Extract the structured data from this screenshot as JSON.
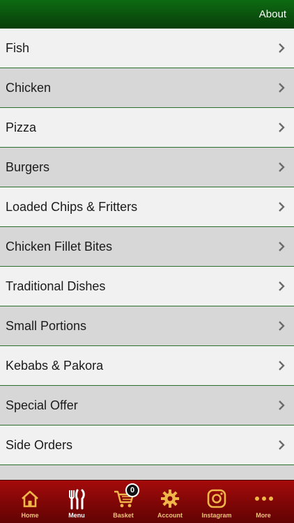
{
  "header": {
    "about_label": "About"
  },
  "menu": {
    "items": [
      {
        "label": "Fish"
      },
      {
        "label": "Chicken"
      },
      {
        "label": "Pizza"
      },
      {
        "label": "Burgers"
      },
      {
        "label": "Loaded Chips & Fritters"
      },
      {
        "label": "Chicken Fillet Bites"
      },
      {
        "label": "Traditional Dishes"
      },
      {
        "label": "Small Portions"
      },
      {
        "label": "Kebabs & Pakora"
      },
      {
        "label": "Special Offer"
      },
      {
        "label": "Side Orders"
      },
      {
        "label": ""
      }
    ]
  },
  "tabbar": {
    "tabs": [
      {
        "label": "Home",
        "icon": "home-icon"
      },
      {
        "label": "Menu",
        "icon": "cutlery-icon"
      },
      {
        "label": "Basket",
        "icon": "cart-icon"
      },
      {
        "label": "Account",
        "icon": "gear-icon"
      },
      {
        "label": "Instagram",
        "icon": "instagram-icon"
      },
      {
        "label": "More",
        "icon": "more-dots-icon"
      }
    ],
    "basket_count": "0"
  },
  "colors": {
    "header_green": "#0a4f0d",
    "tabbar_red": "#7e0606",
    "tab_label_gold": "#f0c47a",
    "divider_green": "#2c6f2c"
  }
}
